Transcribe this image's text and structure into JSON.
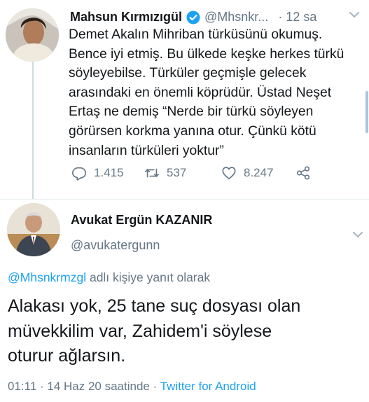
{
  "tweet1": {
    "author_name": "Mahsun Kırmızıgül",
    "handle": "@Mhsnkr...",
    "time": "· 12 sa",
    "text_lines": [
      "Demet Akalın Mihriban türküsünü okumuş.",
      "Bence iyi etmiş. Bu ülkede keşke herkes türkü",
      "söyleyebilse.  Türküler geçmişle gelecek",
      "arasındaki en önemli köprüdür. Üstad Neşet",
      "Ertaş ne demiş  “Nerde bir türkü söyleyen",
      "görürsen korkma yanına otur. Çünkü kötü",
      "insanların türküleri yoktur”"
    ],
    "stats": {
      "replies": "1.415",
      "retweets": "537",
      "likes": "8.247"
    },
    "icons": {
      "verified": "verified-badge-icon",
      "menu": "chevron-down-icon",
      "reply": "reply-icon",
      "retweet": "retweet-icon",
      "like": "heart-icon",
      "share": "share-icon"
    }
  },
  "tweet2": {
    "author_name": "Avukat Ergün KAZANIR",
    "handle": "@avukatergunn",
    "reply_mention": "@Mhsnkrmzgl",
    "reply_suffix": " adlı kişiye yanıt olarak",
    "text_lines": [
      "Alakası yok, 25 tane suç dosyası olan",
      "müvekkilim var, Zahidem'i söylese",
      "oturur ağlarsın."
    ],
    "timestamp": "01:11 · 14 Haz 20 saatinde · ",
    "source": "Twitter for Android",
    "icons": {
      "menu": "chevron-down-icon"
    }
  },
  "colors": {
    "text": "#14171a",
    "secondary": "#657786",
    "accent": "#1da1f2",
    "divider": "#e6ecf0"
  }
}
